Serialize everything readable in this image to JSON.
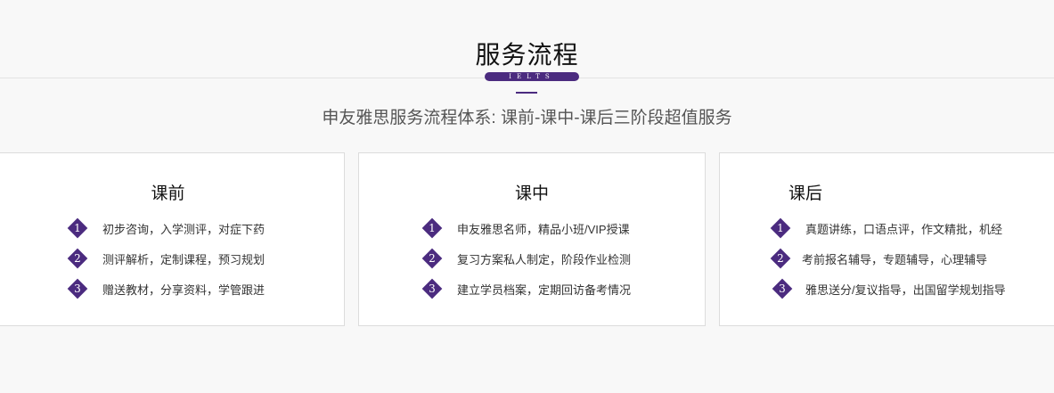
{
  "section": {
    "title": "服务流程",
    "badge": "IELTS",
    "subtitle": "申友雅思服务流程体系: 课前-课中-课后三阶段超值服务"
  },
  "cards": [
    {
      "title": "课前",
      "items": [
        {
          "num": "1",
          "text": "初步咨询，入学测评，对症下药"
        },
        {
          "num": "2",
          "text": "测评解析，定制课程，预习规划"
        },
        {
          "num": "3",
          "text": "赠送教材，分享资料，学管跟进"
        }
      ]
    },
    {
      "title": "课中",
      "items": [
        {
          "num": "1",
          "text": "申友雅思名师，精品小班/VIP授课"
        },
        {
          "num": "2",
          "text": "复习方案私人制定，阶段作业检测"
        },
        {
          "num": "3",
          "text": "建立学员档案，定期回访备考情况"
        }
      ]
    },
    {
      "title": "课后",
      "items": [
        {
          "num": "1",
          "text": "真题讲练，口语点评，作文精批，机经"
        },
        {
          "num": "2",
          "text": "考前报名辅导，专题辅导，心理辅导"
        },
        {
          "num": "3",
          "text": "雅思送分/复议指导，出国留学规划指导"
        }
      ]
    }
  ],
  "colors": {
    "accent": "#4b2b7f",
    "title_highlight": "#9fb8ea"
  }
}
